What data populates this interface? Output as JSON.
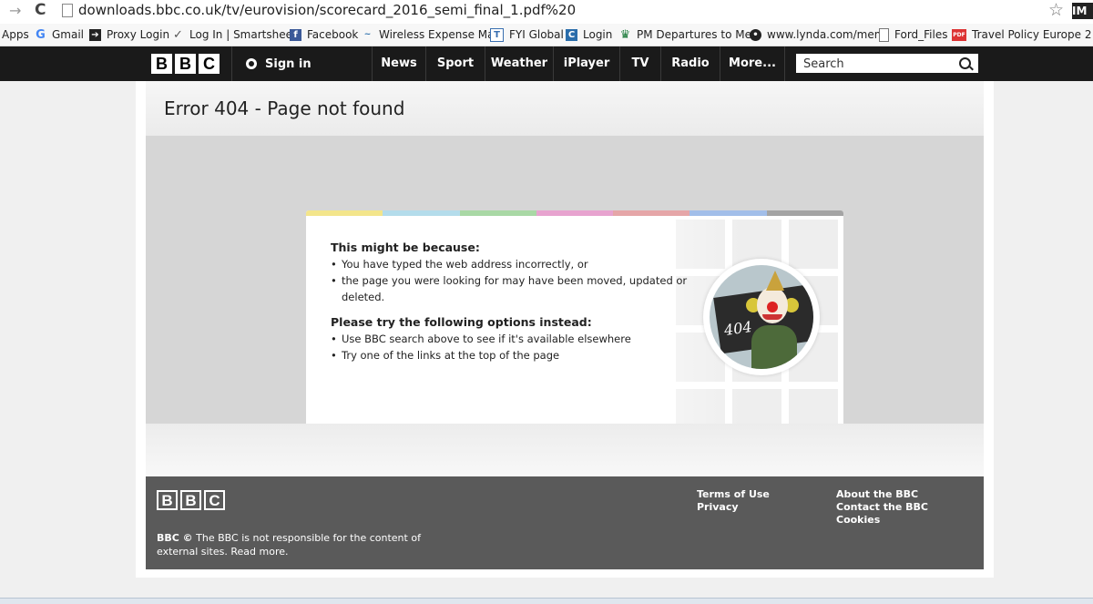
{
  "browser": {
    "url": "downloads.bbc.co.uk/tv/eurovision/scorecard_2016_semi_final_1.pdf%20",
    "extension_label": "IM",
    "bookmarks": [
      {
        "label": "Apps",
        "icon": "apps-icon"
      },
      {
        "label": "Gmail",
        "icon": "google-icon"
      },
      {
        "label": "Proxy Login",
        "icon": "arrow-icon"
      },
      {
        "label": "Log In | Smartsheet",
        "icon": "check-icon"
      },
      {
        "label": "Facebook",
        "icon": "facebook-icon"
      },
      {
        "label": "Wireless Expense Mar",
        "icon": "wireless-icon"
      },
      {
        "label": "FYI Global",
        "icon": "fyi-icon"
      },
      {
        "label": "Login",
        "icon": "login-icon"
      },
      {
        "label": "PM Departures to Me",
        "icon": "crown-icon"
      },
      {
        "label": "www.lynda.com/mem",
        "icon": "globe-icon"
      },
      {
        "label": "Ford_Files",
        "icon": "page-icon"
      },
      {
        "label": "Travel Policy Europe 2",
        "icon": "pdf-icon"
      }
    ]
  },
  "bbc_header": {
    "logo": [
      "B",
      "B",
      "C"
    ],
    "sign_in": "Sign in",
    "nav": [
      "News",
      "Sport",
      "Weather",
      "iPlayer",
      "TV",
      "Radio",
      "More..."
    ],
    "search_placeholder": "Search"
  },
  "page": {
    "title": "Error 404 - Page not found",
    "reasons_heading": "This might be because:",
    "reasons": [
      "You have typed the web address incorrectly, or",
      "the page you were looking for may have been moved, updated or deleted."
    ],
    "options_heading": "Please try the following options instead:",
    "options": [
      "Use BBC search above to see if it's available elsewhere",
      "Try one of the links at the top of the page"
    ],
    "image_text": "404"
  },
  "footer": {
    "logo": [
      "B",
      "B",
      "C"
    ],
    "links_col1": [
      "Terms of Use",
      "Privacy"
    ],
    "links_col2": [
      "About the BBC",
      "Contact the BBC",
      "Cookies"
    ],
    "copyright_prefix": "BBC ©",
    "copyright_text": "The BBC is not responsible for the content of external sites.",
    "read_more": "Read more."
  },
  "colors": {
    "top_bar": [
      "#f3e58b",
      "#b4dceb",
      "#a9d8a5",
      "#e7a3cf",
      "#e5a6a8",
      "#a2bee9",
      "#a4a4a4"
    ],
    "bottom_bar": [
      "#a9d8a5",
      "#a4a4a4",
      "#a9d8a5",
      "#a4a4a4",
      "#a9d8a5",
      "#a4a4a4",
      "#a9d8a5",
      "#a4a4a4",
      "#a9d8a5",
      "#a4a4a4",
      "#a9d8a5",
      "#a4a4a4",
      "#a9d8a5",
      "#a4a4a4",
      "#a9d8a5",
      "#a4a4a4"
    ],
    "header_bg": "#1a1a1a",
    "footer_bg": "#5a5a5a"
  }
}
